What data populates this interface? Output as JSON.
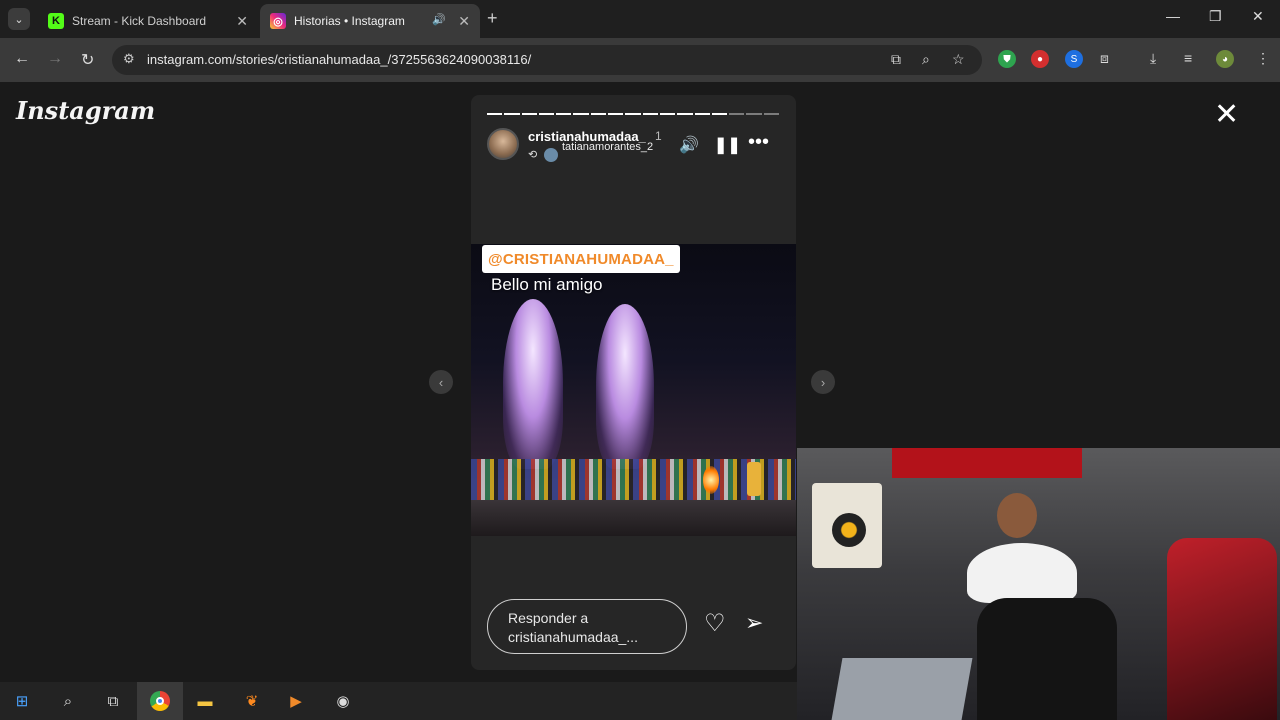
{
  "browser": {
    "tabs": [
      {
        "title": "Stream - Kick Dashboard",
        "favicon": "kick-icon"
      },
      {
        "title": "Historias • Instagram",
        "favicon": "instagram-icon"
      }
    ],
    "url": "instagram.com/stories/cristianahumadaa_/3725563624090038116/"
  },
  "instagram": {
    "logo": "Instagram",
    "story": {
      "username": "cristianahumadaa_",
      "time": "1",
      "reposted_from": "tatianamorantes_2",
      "mention_sticker": "@CRISTIANAHUMADAA_",
      "caption": "Bello mi amigo",
      "reply_placeholder": "Responder a cristianahumadaa_...",
      "progress_segments_total": 17,
      "progress_segments_done": 14
    }
  },
  "colors": {
    "background": "#1a1a1a",
    "story_panel": "#262626",
    "sticker_text": "#f08a2a"
  }
}
